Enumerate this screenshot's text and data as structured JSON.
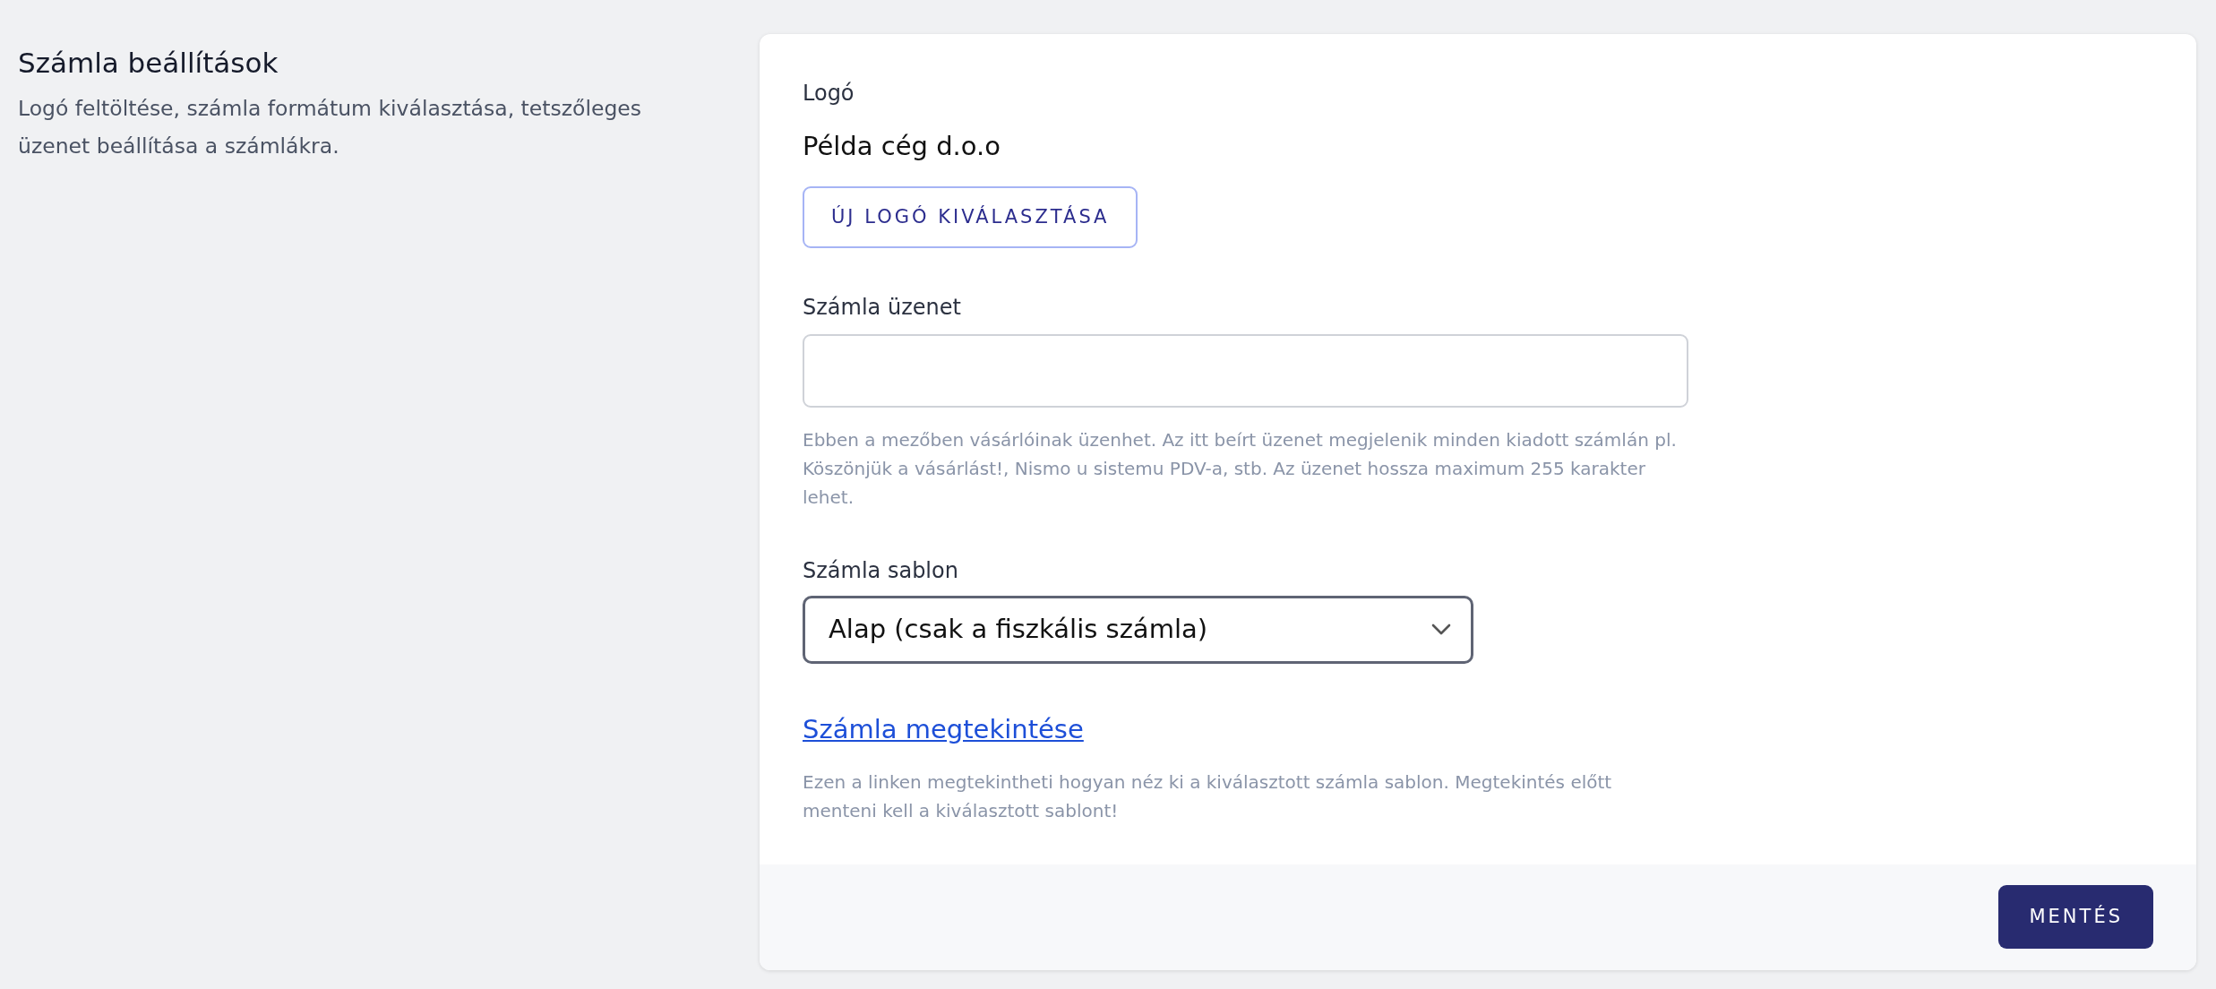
{
  "section": {
    "title": "Számla beállítások",
    "description": "Logó feltöltése, számla formátum kiválasztása, tetszőleges üzenet beállítása a számlákra."
  },
  "logo": {
    "label": "Logó",
    "company": "Példa cég d.o.o",
    "button": "ÚJ LOGÓ KIVÁLASZTÁSA"
  },
  "message": {
    "label": "Számla üzenet",
    "help": "Ebben a mezőben vásárlóinak üzenhet. Az itt beírt üzenet megjelenik minden kiadott számlán pl. Köszönjük a vásárlást!, Nismo u sistemu PDV-a, stb. Az üzenet hossza maximum 255 karakter lehet."
  },
  "template": {
    "label": "Számla sablon",
    "value": "Alap (csak a fiszkális számla)",
    "focused": true
  },
  "preview": {
    "link": "Számla megtekintése",
    "help": "Ezen a linken megtekintheti hogyan néz ki a kiválasztott számla sablon. Megtekintés előtt menteni kell a kiválasztott sablont!"
  },
  "footer": {
    "button": "MENTÉS"
  }
}
